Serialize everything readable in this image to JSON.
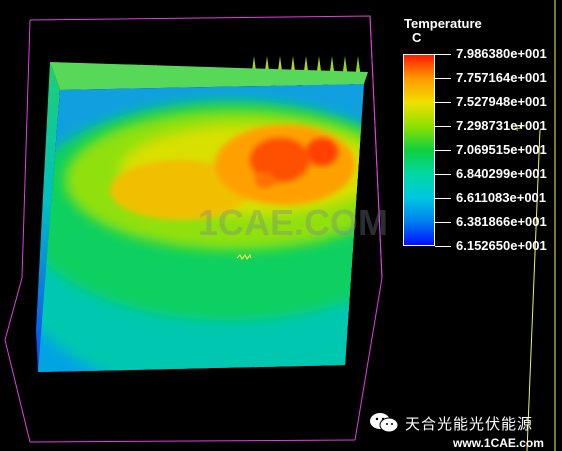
{
  "legend": {
    "title": "Temperature",
    "unit": "C",
    "labels": [
      "7.986380e+001",
      "7.757164e+001",
      "7.527948e+001",
      "7.298731e+001",
      "7.069515e+001",
      "6.840299e+001",
      "6.611083e+001",
      "6.381866e+001",
      "6.152650e+001"
    ],
    "colors": [
      "#ff1a00",
      "#ff9a00",
      "#f0e000",
      "#8fe000",
      "#10d040",
      "#00d8a0",
      "#00c8e0",
      "#0080f0",
      "#0010ff"
    ]
  },
  "watermark": {
    "center": "1CAE.COM"
  },
  "branding": {
    "name": "天合光能光伏能源",
    "site": "www.1CAE.com"
  },
  "icons": {
    "wechat": "wechat-icon"
  }
}
